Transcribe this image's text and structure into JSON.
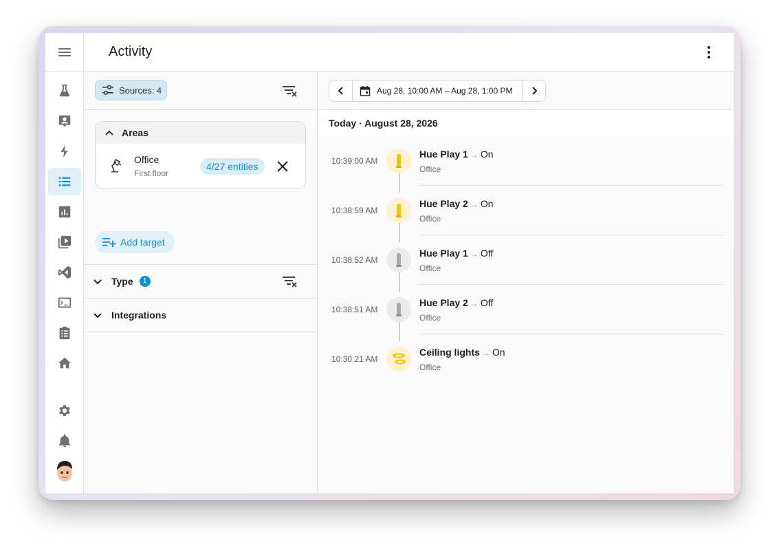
{
  "header": {
    "title": "Activity",
    "more_icon": "dots-vertical-icon"
  },
  "sidebar": {
    "menu_icon": "menu-icon",
    "items": [
      {
        "name": "flask-icon",
        "active": false
      },
      {
        "name": "account-box-icon",
        "active": false
      },
      {
        "name": "lightning-bolt-icon",
        "active": false
      },
      {
        "name": "format-list-icon",
        "active": true
      },
      {
        "name": "chart-box-icon",
        "active": false
      },
      {
        "name": "play-box-multiple-icon",
        "active": false
      },
      {
        "name": "vscode-icon",
        "active": false
      },
      {
        "name": "terminal-icon",
        "active": false
      },
      {
        "name": "clipboard-list-icon",
        "active": false
      },
      {
        "name": "home-icon",
        "active": false
      }
    ],
    "bottom_items": [
      {
        "name": "gear-icon"
      },
      {
        "name": "bell-icon"
      }
    ],
    "avatar": "user-avatar"
  },
  "filters": {
    "sources_label": "Sources: 4",
    "areas": {
      "title": "Areas",
      "item": {
        "name": "Office",
        "floor": "First floor",
        "entities": "4/27 entities"
      }
    },
    "add_target_label": "Add target",
    "type_label": "Type",
    "type_count": "1",
    "integrations_label": "Integrations"
  },
  "range": {
    "label": "Aug 28, 10:00 AM – Aug 28, 1:00 PM"
  },
  "day_header": "Today · August 28, 2026",
  "colors": {
    "accent": "#0b8ed1",
    "on": "#f4c20d",
    "off": "#9e9e9e"
  },
  "events": [
    {
      "time": "10:39:00 AM",
      "name": "Hue Play 1",
      "state": "On",
      "area": "Office",
      "icon": "light-bar-icon"
    },
    {
      "time": "10:38:59 AM",
      "name": "Hue Play 2",
      "state": "On",
      "area": "Office",
      "icon": "light-bar-icon"
    },
    {
      "time": "10:38:52 AM",
      "name": "Hue Play 1",
      "state": "Off",
      "area": "Office",
      "icon": "light-bar-icon"
    },
    {
      "time": "10:38:51 AM",
      "name": "Hue Play 2",
      "state": "Off",
      "area": "Office",
      "icon": "light-bar-icon"
    },
    {
      "time": "10:30:21 AM",
      "name": "Ceiling lights",
      "state": "On",
      "area": "Office",
      "icon": "ceiling-light-icon"
    }
  ]
}
